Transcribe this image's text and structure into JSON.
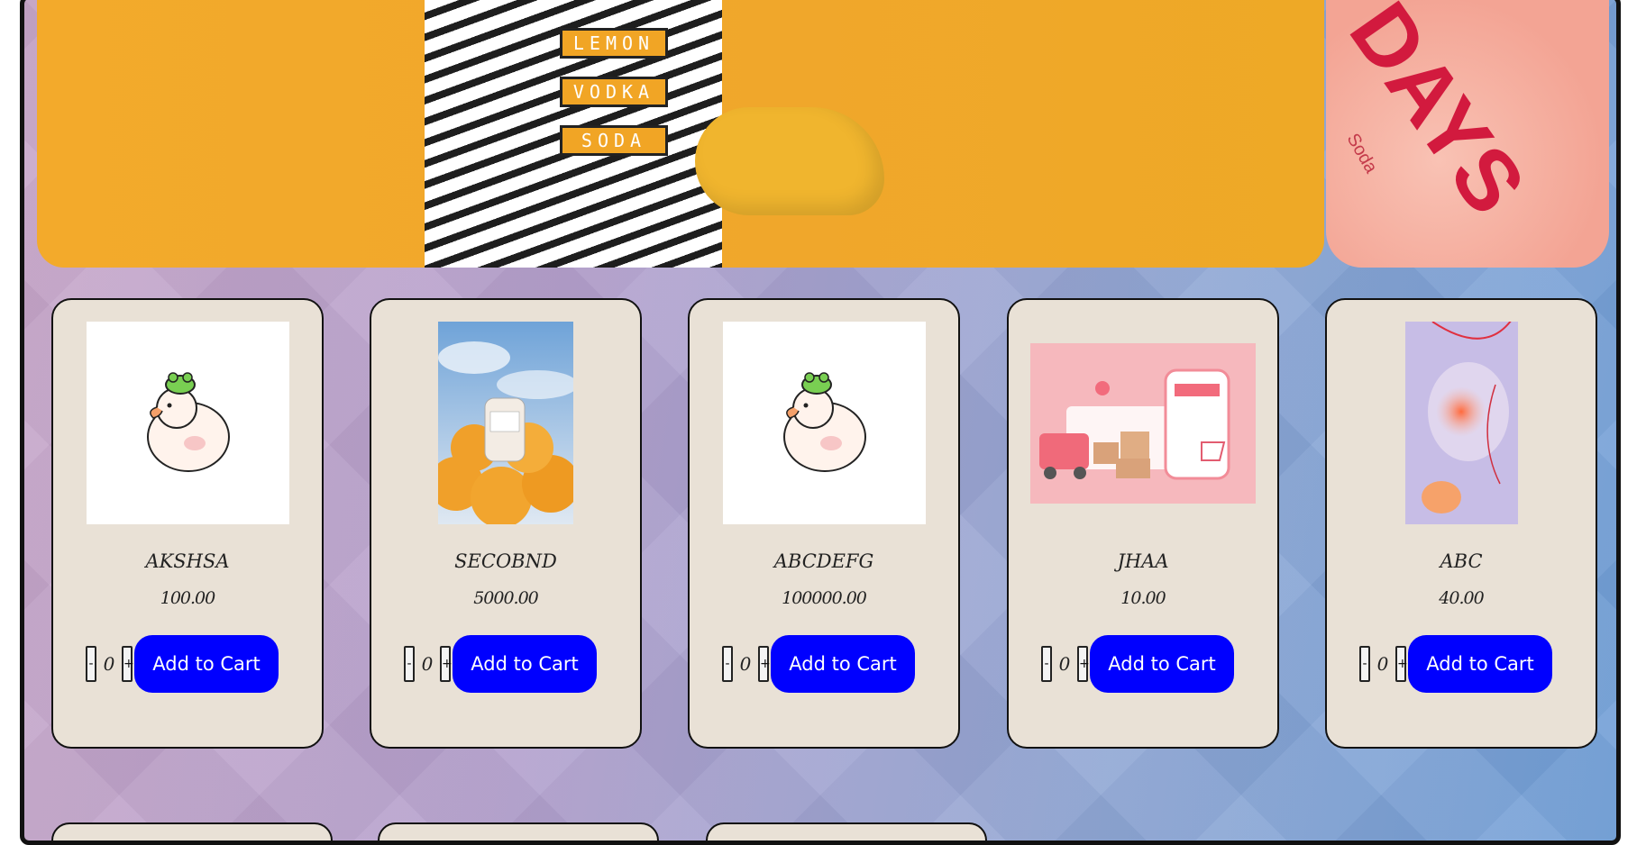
{
  "hero": {
    "can_labels": [
      "LEMON",
      "VODKA",
      "SODA"
    ],
    "side_text": "DAYS",
    "side_small": "Soda"
  },
  "products": [
    {
      "name": "AKSHSA",
      "price": "100.00",
      "qty": "0",
      "minus": "-",
      "plus": "+",
      "add_label": "Add to Cart",
      "image": "duck-with-frog"
    },
    {
      "name": "SECOBND",
      "price": "5000.00",
      "qty": "0",
      "minus": "-",
      "plus": "+",
      "add_label": "Add to Cart",
      "image": "serum-bottle-oranges"
    },
    {
      "name": "ABCDEFG",
      "price": "100000.00",
      "qty": "0",
      "minus": "-",
      "plus": "+",
      "add_label": "Add to Cart",
      "image": "duck-with-frog"
    },
    {
      "name": "JHAA",
      "price": "10.00",
      "qty": "0",
      "minus": "-",
      "plus": "+",
      "add_label": "Add to Cart",
      "image": "delivery-truck-phone"
    },
    {
      "name": "ABC",
      "price": "40.00",
      "qty": "0",
      "minus": "-",
      "plus": "+",
      "add_label": "Add to Cart",
      "image": "abstract-shapes"
    }
  ],
  "colors": {
    "card_bg": "#e9e1d6",
    "add_button": "#0000ff",
    "hero_orange": "#f0a72b"
  }
}
